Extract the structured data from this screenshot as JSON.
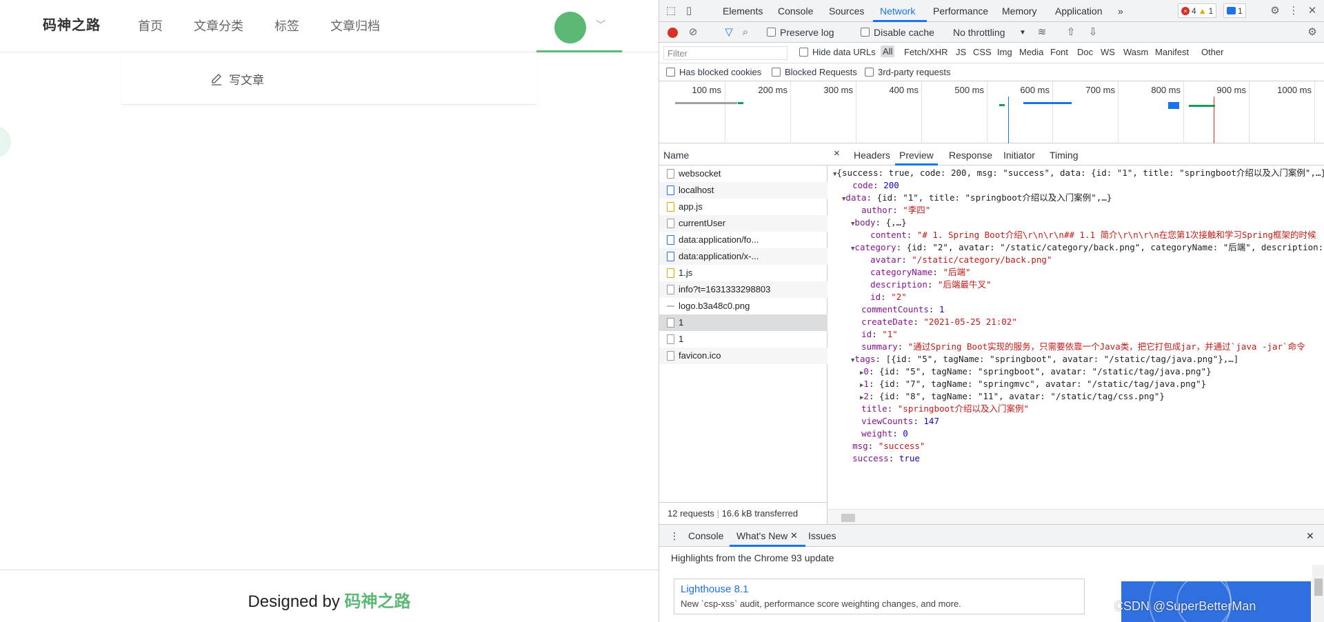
{
  "site": {
    "logo": "码神之路",
    "nav": [
      "首页",
      "文章分类",
      "标签",
      "文章归档"
    ],
    "write_label": "写文章",
    "footer_prefix": "Designed by ",
    "footer_brand": "码神之路",
    "accent": "#5cb875"
  },
  "devtools": {
    "tabs": [
      "Elements",
      "Console",
      "Sources",
      "Network",
      "Performance",
      "Memory",
      "Application"
    ],
    "active_tab": "Network",
    "more_tabs": "»",
    "errors": "4",
    "warnings": "1",
    "messages": "1",
    "toolbar": {
      "preserve_log": "Preserve log",
      "disable_cache": "Disable cache",
      "throttling": "No throttling"
    },
    "filter": {
      "placeholder": "Filter",
      "hide_data_urls": "Hide data URLs",
      "types": [
        "All",
        "Fetch/XHR",
        "JS",
        "CSS",
        "Img",
        "Media",
        "Font",
        "Doc",
        "WS",
        "Wasm",
        "Manifest",
        "Other"
      ],
      "has_blocked": "Has blocked cookies",
      "blocked_requests": "Blocked Requests",
      "third_party": "3rd-party requests"
    },
    "timeline_ticks": [
      "100 ms",
      "200 ms",
      "300 ms",
      "400 ms",
      "500 ms",
      "600 ms",
      "700 ms",
      "800 ms",
      "900 ms",
      "1000 ms"
    ],
    "list": {
      "header": "Name",
      "requests": [
        {
          "name": "websocket",
          "icon": "file-icon"
        },
        {
          "name": "localhost",
          "icon": "document-icon"
        },
        {
          "name": "app.js",
          "icon": "script-icon"
        },
        {
          "name": "currentUser",
          "icon": "file-icon"
        },
        {
          "name": "data:application/fo...",
          "icon": "font-icon"
        },
        {
          "name": "data:application/x-...",
          "icon": "font-icon"
        },
        {
          "name": "1.js",
          "icon": "script-icon"
        },
        {
          "name": "info?t=1631333298803",
          "icon": "file-icon"
        },
        {
          "name": "logo.b3a48c0.png",
          "icon": "image-icon"
        },
        {
          "name": "1",
          "icon": "file-icon"
        },
        {
          "name": "1",
          "icon": "file-icon"
        },
        {
          "name": "favicon.ico",
          "icon": "file-icon"
        }
      ],
      "status_requests": "12 requests",
      "status_transferred": "16.6 kB transferred"
    },
    "preview_tabs": [
      "Headers",
      "Preview",
      "Response",
      "Initiator",
      "Timing"
    ],
    "active_preview_tab": "Preview",
    "json_lines": [
      {
        "indent": 0,
        "tri": "▼",
        "text": "{success: true, code: 200, msg: \"success\", data: {id: \"1\", title: \"springboot介绍以及入门案例\",…}"
      },
      {
        "indent": 1,
        "key": "code",
        "num": "200"
      },
      {
        "indent": 1,
        "tri": "▼",
        "key": "data",
        "plain": "{id: \"1\", title: \"springboot介绍以及入门案例\",…}"
      },
      {
        "indent": 2,
        "key": "author",
        "str": "\"李四\""
      },
      {
        "indent": 2,
        "tri": "▼",
        "key": "body",
        "plain": "{,…}"
      },
      {
        "indent": 3,
        "key": "content",
        "str": "\"# 1. Spring Boot介绍\\r\\n\\r\\n## 1.1 简介\\r\\n\\r\\n在您第1次接触和学习Spring框架的时候"
      },
      {
        "indent": 2,
        "tri": "▼",
        "key": "category",
        "plain": "{id: \"2\", avatar: \"/static/category/back.png\", categoryName: \"后端\", description:"
      },
      {
        "indent": 3,
        "key": "avatar",
        "str": "\"/static/category/back.png\""
      },
      {
        "indent": 3,
        "key": "categoryName",
        "str": "\"后端\""
      },
      {
        "indent": 3,
        "key": "description",
        "str": "\"后端最牛叉\""
      },
      {
        "indent": 3,
        "key": "id",
        "str": "\"2\""
      },
      {
        "indent": 2,
        "key": "commentCounts",
        "num": "1"
      },
      {
        "indent": 2,
        "key": "createDate",
        "str": "\"2021-05-25 21:02\""
      },
      {
        "indent": 2,
        "key": "id",
        "str": "\"1\""
      },
      {
        "indent": 2,
        "key": "summary",
        "str": "\"通过Spring Boot实现的服务，只需要依靠一个Java类，把它打包成jar，并通过`java -jar`命令"
      },
      {
        "indent": 2,
        "tri": "▼",
        "key": "tags",
        "plain": "[{id: \"5\", tagName: \"springboot\", avatar: \"/static/tag/java.png\"},…]"
      },
      {
        "indent": 3,
        "tri": "▶",
        "key": "0",
        "plain": "{id: \"5\", tagName: \"springboot\", avatar: \"/static/tag/java.png\"}"
      },
      {
        "indent": 3,
        "tri": "▶",
        "key": "1",
        "plain": "{id: \"7\", tagName: \"springmvc\", avatar: \"/static/tag/java.png\"}"
      },
      {
        "indent": 3,
        "tri": "▶",
        "key": "2",
        "plain": "{id: \"8\", tagName: \"11\", avatar: \"/static/tag/css.png\"}"
      },
      {
        "indent": 2,
        "key": "title",
        "str": "\"springboot介绍以及入门案例\""
      },
      {
        "indent": 2,
        "key": "viewCounts",
        "num": "147"
      },
      {
        "indent": 2,
        "key": "weight",
        "num": "0"
      },
      {
        "indent": 1,
        "key": "msg",
        "str": "\"success\""
      },
      {
        "indent": 1,
        "key": "success",
        "num": "true"
      }
    ],
    "drawer": {
      "tabs": [
        "Console",
        "What's New",
        "Issues"
      ],
      "active": "What's New",
      "title": "Highlights from the Chrome 93 update",
      "card_title": "Lighthouse 8.1",
      "card_desc": "New `csp-xss` audit, performance score weighting changes, and more.",
      "watermark": "CSDN @SuperBetterMan"
    }
  }
}
